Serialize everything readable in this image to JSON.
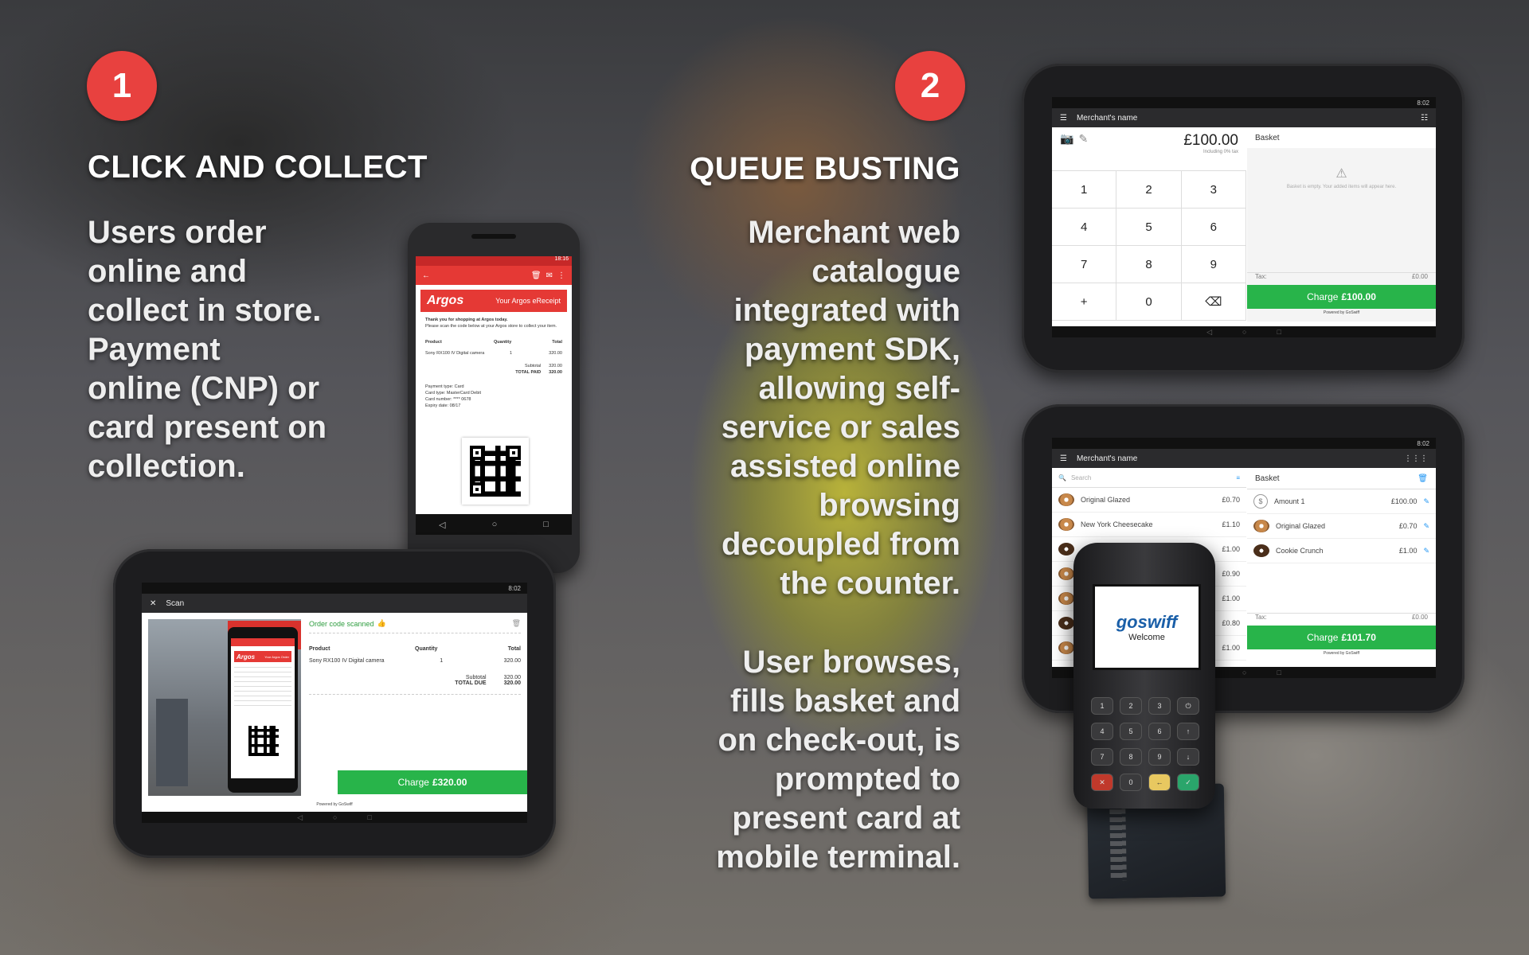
{
  "section1": {
    "number": "1",
    "heading": "CLICK AND COLLECT",
    "text": [
      "Users order",
      "online and",
      "collect in store.",
      "Payment",
      "online (CNP) or",
      "card present on",
      "collection."
    ]
  },
  "section2": {
    "number": "2",
    "heading": "QUEUE BUSTING",
    "text1": [
      "Merchant web",
      "catalogue",
      "integrated with",
      "payment SDK,",
      "allowing self-",
      "service or sales",
      "assisted online",
      "browsing",
      "decoupled from",
      "the counter."
    ],
    "text2": [
      "User browses,",
      "fills basket and",
      "on check-out, is",
      "prompted to",
      "present card at",
      "mobile terminal."
    ]
  },
  "phone": {
    "time": "18:16",
    "brand": "Argos",
    "title": "Your Argos eReceipt",
    "thanks": "Thank you for shopping at Argos today.",
    "instruction": "Please scan the code below at your Argos store to collect your item.",
    "headers": [
      "Product",
      "Quantity",
      "Total"
    ],
    "product": "Sony RX100 IV Digital camera",
    "qty": "1",
    "total": "320.00",
    "subtotal_label": "Subtotal",
    "subtotal": "320.00",
    "paid_label": "TOTAL PAID",
    "paid": "320.00",
    "payment_lines": [
      "Payment type: Card",
      "Card type: MasterCard Debit",
      "Card number: **** 0678",
      "Expiry date: 08/17"
    ]
  },
  "scan_tablet": {
    "time": "8:02",
    "title": "Scan",
    "mini_brand": "Argos",
    "mini_title": "Your Argos Order",
    "scanned": "Order code scanned",
    "headers": [
      "Product",
      "Quantity",
      "Total"
    ],
    "product": "Sony RX100 IV Digital camera",
    "qty": "1",
    "total": "320.00",
    "subtotal_label": "Subtotal",
    "subtotal": "320.00",
    "due_label": "TOTAL DUE",
    "due": "320.00",
    "charge_label": "Charge",
    "charge_amount": "£320.00",
    "powered": "Powered by GoSwiff"
  },
  "pos_tablet": {
    "time": "8:02",
    "merchant": "Merchant's name",
    "amount": "£100.00",
    "tax_note": "Including 0% tax",
    "keys": [
      "1",
      "2",
      "3",
      "4",
      "5",
      "6",
      "7",
      "8",
      "9",
      "+",
      "0",
      "⌫"
    ],
    "basket": "Basket",
    "empty": "Basket is empty. Your added items will appear here.",
    "tax_label": "Tax:",
    "tax_value": "£0.00",
    "charge_label": "Charge",
    "charge_amount": "£100.00",
    "powered": "Powered by GoSwiff"
  },
  "catalog_tablet": {
    "time": "8:02",
    "merchant": "Merchant's name",
    "search": "Search",
    "items": [
      {
        "name": "Original Glazed",
        "price": "£0.70"
      },
      {
        "name": "New York Cheesecake",
        "price": "£1.10"
      },
      {
        "name": "",
        "price": "£1.00"
      },
      {
        "name": "",
        "price": "£0.90"
      },
      {
        "name": "",
        "price": "£1.00"
      },
      {
        "name": "",
        "price": "£0.80"
      },
      {
        "name": "",
        "price": "£1.00"
      }
    ],
    "basket": "Basket",
    "basket_items": [
      {
        "name": "Amount 1",
        "price": "£100.00"
      },
      {
        "name": "Original Glazed",
        "price": "£0.70"
      },
      {
        "name": "Cookie Crunch",
        "price": "£1.00"
      }
    ],
    "tax_label": "Tax:",
    "tax_value": "£0.00",
    "charge_label": "Charge",
    "charge_amount": "£101.70",
    "powered": "Powered by GoSwiff"
  },
  "terminal": {
    "brand": "goswiff",
    "welcome": "Welcome",
    "keys": [
      "1",
      "2",
      "3",
      "⏻",
      "4",
      "5",
      "6",
      "↑",
      "7",
      "8",
      "9",
      "↓",
      "✕",
      "0",
      "←",
      "✓"
    ],
    "key_colors": {
      "cancel": "#c0392b",
      "clear": "#e8c860",
      "enter": "#2aa56b"
    }
  },
  "colors": {
    "badge": "#e8413f",
    "argos_red": "#e53935",
    "charge_green": "#28b44a"
  }
}
